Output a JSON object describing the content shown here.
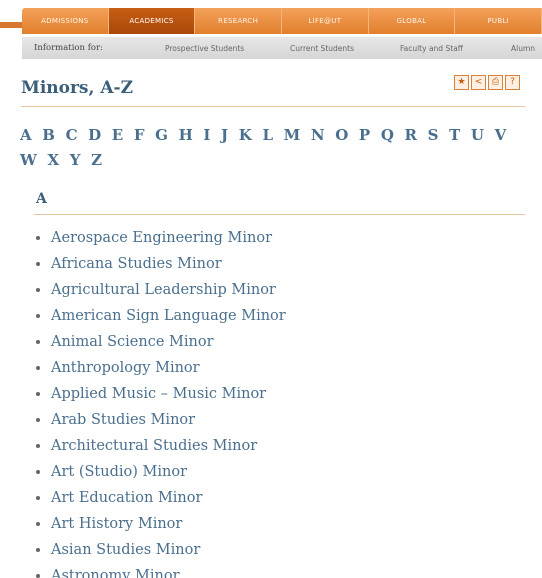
{
  "nav": {
    "items": [
      "ADMISSIONS",
      "ACADEMICS",
      "RESEARCH",
      "LIFE@UT",
      "GLOBAL",
      "PUBLI"
    ],
    "active_index": 1
  },
  "infobar": {
    "label": "Information for:",
    "links": [
      "Prospective Students",
      "Current Students",
      "Faculty and Staff",
      "Alumn"
    ]
  },
  "page": {
    "title": "Minors, A-Z",
    "tools": {
      "bookmark": "★",
      "share": "<",
      "print": "⎙",
      "help": "?"
    }
  },
  "alphabet": [
    "A",
    "B",
    "C",
    "D",
    "E",
    "F",
    "G",
    "H",
    "I",
    "J",
    "K",
    "L",
    "M",
    "N",
    "O",
    "P",
    "Q",
    "R",
    "S",
    "T",
    "U",
    "V",
    "W",
    "X",
    "Y",
    "Z"
  ],
  "section": {
    "letter": "A",
    "minors": [
      "Aerospace Engineering Minor",
      "Africana Studies Minor",
      "Agricultural Leadership Minor",
      "American Sign Language Minor",
      "Animal Science Minor",
      "Anthropology Minor",
      "Applied Music – Music Minor",
      "Arab Studies Minor",
      "Architectural Studies Minor",
      "Art (Studio) Minor",
      "Art Education Minor",
      "Art History Minor",
      "Asian Studies Minor",
      "Astronomy Minor"
    ]
  },
  "colors": {
    "accent_orange": "#e17f2c",
    "active_tab": "#b5520f",
    "link_blue": "#4a6f8e",
    "heading_blue": "#3b5e79"
  }
}
